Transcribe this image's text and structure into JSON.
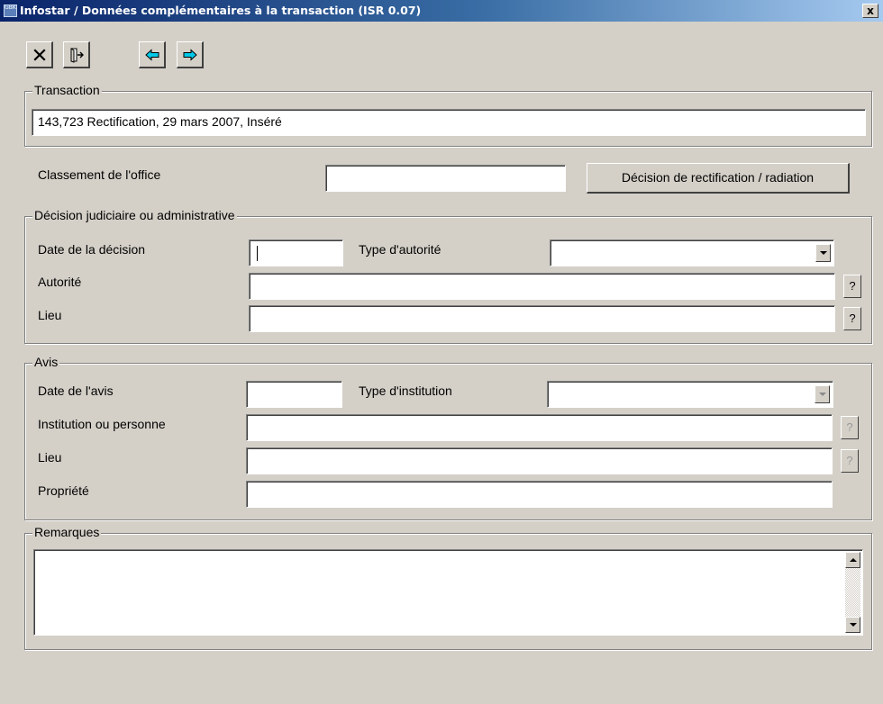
{
  "window": {
    "title": "Infostar / Données complémentaires à la transaction (ISR 0.07)",
    "app_icon_text": "GBK",
    "close_label": "x"
  },
  "toolbar": {
    "buttons": [
      {
        "name": "cancel",
        "icon": "x-icon"
      },
      {
        "name": "exit",
        "icon": "exit-door-icon"
      },
      {
        "name": "previous",
        "icon": "left-arrow-icon"
      },
      {
        "name": "next",
        "icon": "right-arrow-icon"
      }
    ]
  },
  "transaction": {
    "legend": "Transaction",
    "value": "143,723  Rectification, 29 mars 2007, Inséré"
  },
  "classement": {
    "label": "Classement de l'office",
    "value": "",
    "button_label": "Décision de rectification / radiation"
  },
  "decision": {
    "legend": "Décision judiciaire ou administrative",
    "date_label": "Date de la décision",
    "date_value": "",
    "type_label": "Type d'autorité",
    "type_value": "",
    "autorite_label": "Autorité",
    "autorite_value": "",
    "lieu_label": "Lieu",
    "lieu_value": "",
    "help_label": "?"
  },
  "avis": {
    "legend": "Avis",
    "date_label": "Date de l'avis",
    "date_value": "",
    "type_label": "Type d'institution",
    "type_value": "",
    "institution_label": "Institution ou personne",
    "institution_value": "",
    "lieu_label": "Lieu",
    "lieu_value": "",
    "propriete_label": "Propriété",
    "propriete_value": "",
    "help_label": "?"
  },
  "remarques": {
    "legend": "Remarques",
    "value": ""
  },
  "colors": {
    "window_bg": "#d4d0c8",
    "titlebar_start": "#0a246a",
    "titlebar_end": "#a6caf0",
    "arrow_cyan": "#00c8e8"
  }
}
